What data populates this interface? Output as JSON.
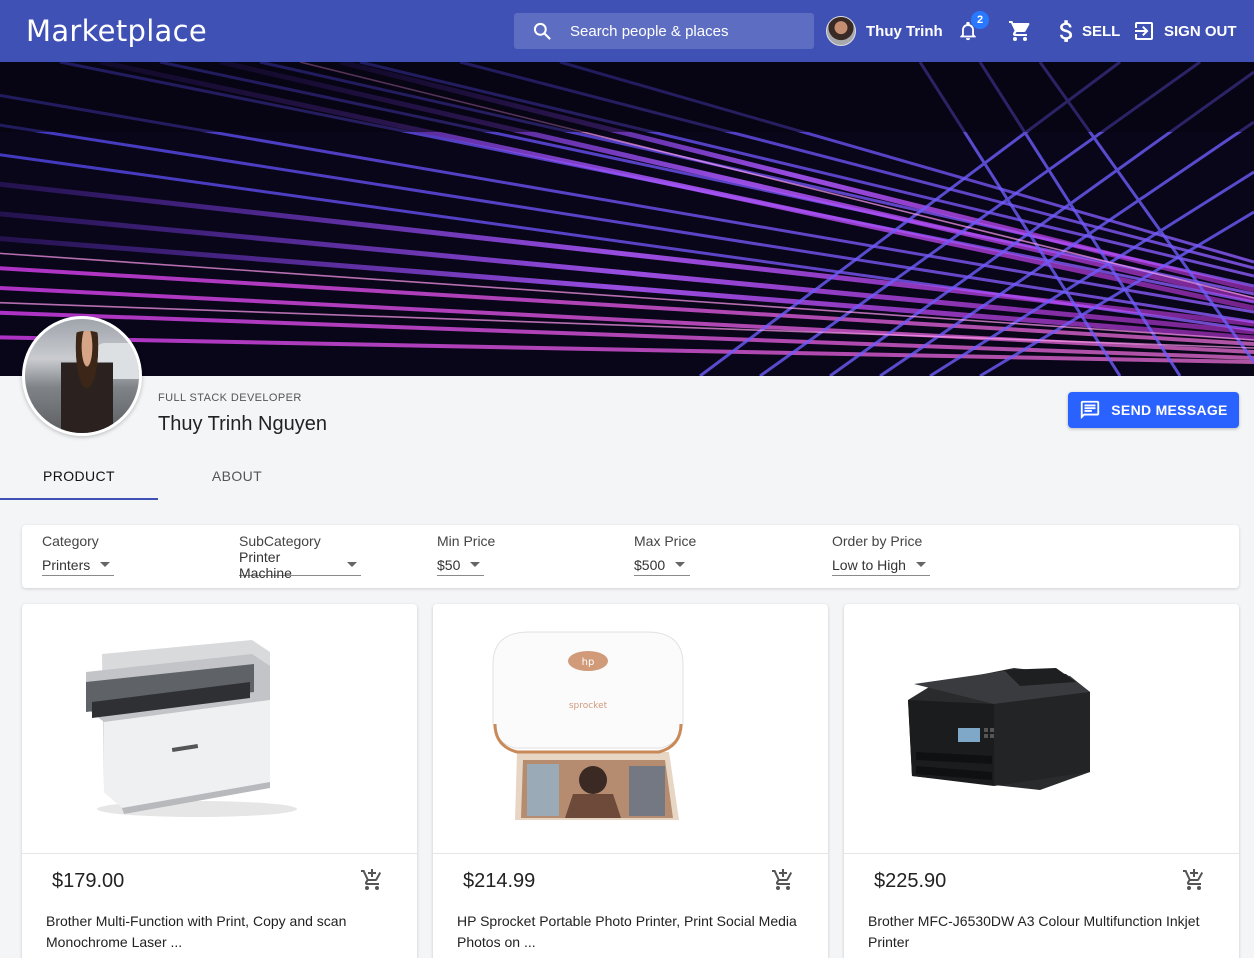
{
  "app": {
    "title": "Marketplace"
  },
  "search": {
    "placeholder": "Search people & places"
  },
  "user": {
    "name": "Thuy Trinh"
  },
  "notifications": {
    "count": "2"
  },
  "nav": {
    "sell": "SELL",
    "sign_out": "SIGN OUT"
  },
  "profile": {
    "role": "FULL STACK DEVELOPER",
    "name": "Thuy Trinh Nguyen",
    "send_message": "SEND MESSAGE"
  },
  "tabs": [
    {
      "label": "PRODUCT",
      "active": true
    },
    {
      "label": "ABOUT",
      "active": false
    }
  ],
  "filters": [
    {
      "label": "Category",
      "value": "Printers"
    },
    {
      "label": "SubCategory",
      "value": "Printer Machine"
    },
    {
      "label": "Min Price",
      "value": "$50"
    },
    {
      "label": "Max Price",
      "value": "$500"
    },
    {
      "label": "Order by Price",
      "value": "Low to High"
    }
  ],
  "products": [
    {
      "price": "$179.00",
      "title": "Brother Multi-Function with Print, Copy and scan Monochrome Laser ..."
    },
    {
      "price": "$214.99",
      "title": "HP Sprocket Portable Photo Printer, Print Social Media Photos on ..."
    },
    {
      "price": "$225.90",
      "title": "Brother MFC-J6530DW A3 Colour Multifunction Inkjet Printer"
    }
  ],
  "colors": {
    "appbar": "#3f51b5",
    "accent": "#2962ff",
    "badge": "#2979ff"
  },
  "icons": [
    "search-icon",
    "bell-icon",
    "cart-icon",
    "dollar-icon",
    "sign-out-icon",
    "message-icon",
    "add-to-cart-icon"
  ]
}
